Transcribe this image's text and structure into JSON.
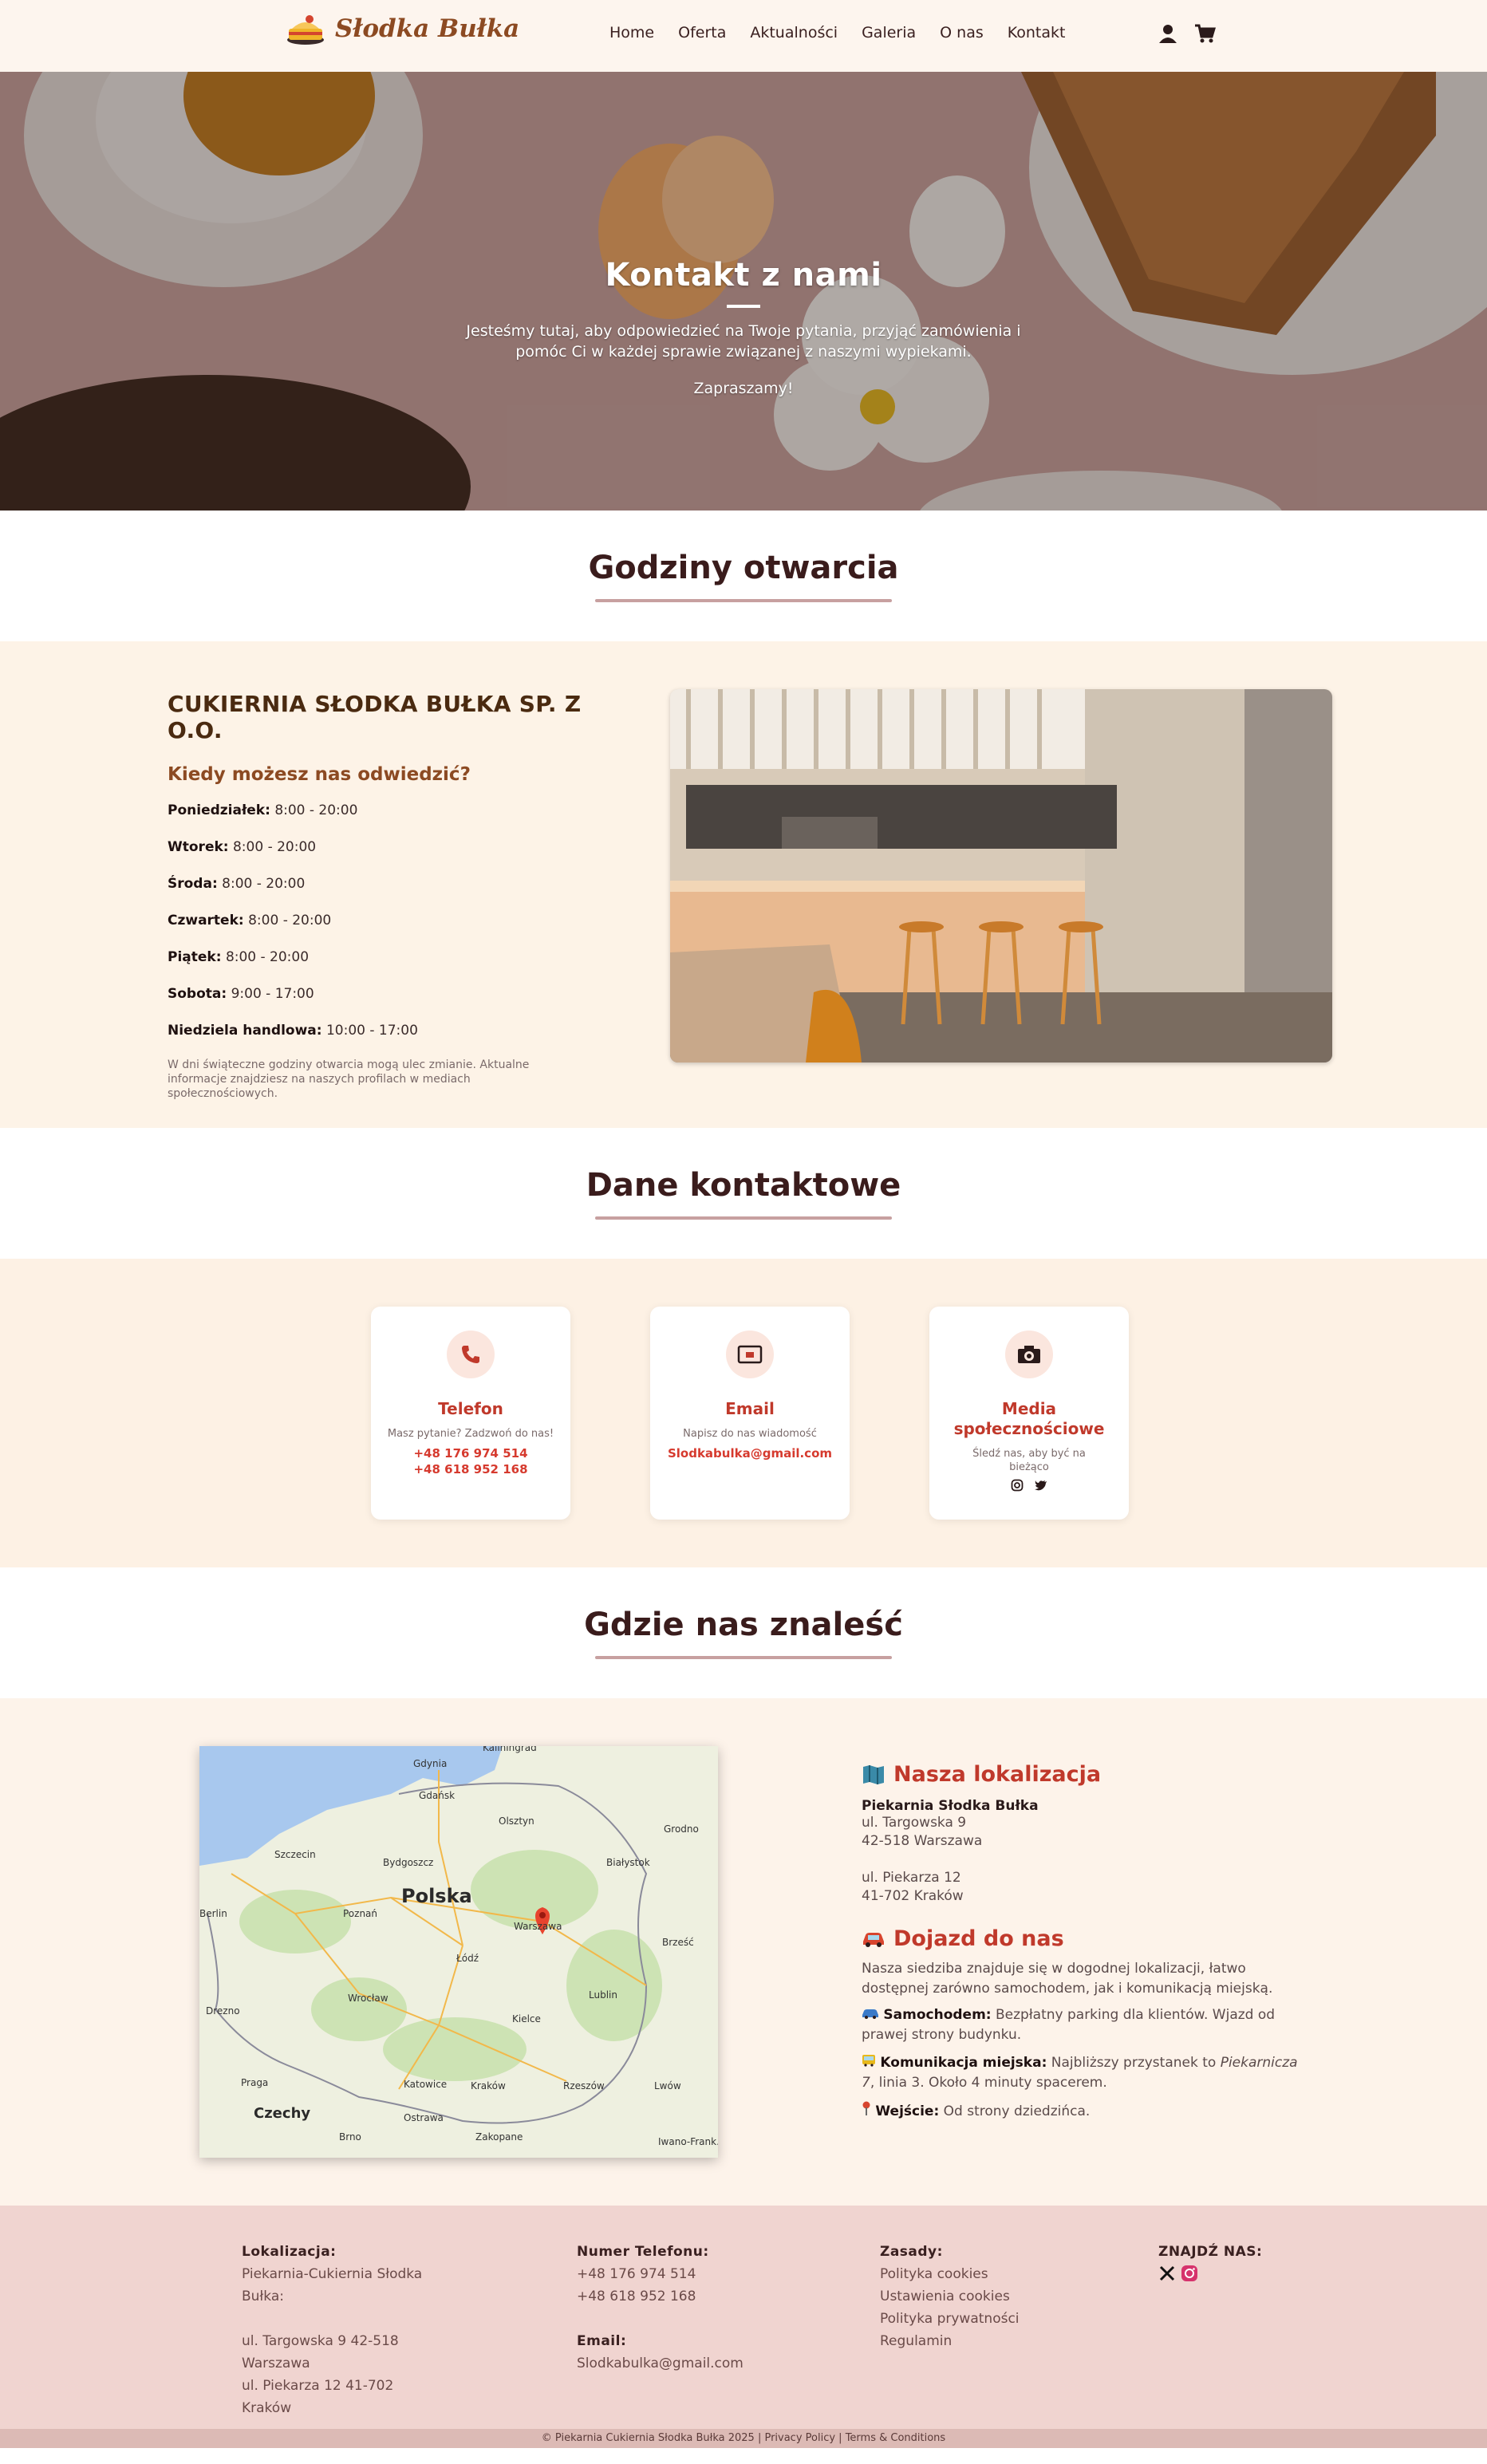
{
  "header": {
    "brand": "Słodka Bułka",
    "nav": [
      "Home",
      "Oferta",
      "Aktualności",
      "Galeria",
      "O nas",
      "Kontakt"
    ],
    "icons": [
      "user-icon",
      "cart-icon"
    ]
  },
  "hero": {
    "title": "Kontakt z nami",
    "text": "Jesteśmy tutaj, aby odpowiedzieć na Twoje pytania, przyjąć zamówienia i pomóc Ci w każdej sprawie związanej z naszymi wypiekami.",
    "invite": "Zapraszamy!"
  },
  "hours": {
    "section_title": "Godziny otwarcia",
    "company": "CUKIERNIA SŁODKA BUŁKA SP. Z O.O.",
    "subtitle": "Kiedy możesz nas odwiedzić?",
    "days": [
      {
        "day": "Poniedziałek:",
        "time": "8:00 - 20:00"
      },
      {
        "day": "Wtorek:",
        "time": "8:00 - 20:00"
      },
      {
        "day": "Środa:",
        "time": "8:00 - 20:00"
      },
      {
        "day": "Czwartek:",
        "time": "8:00 - 20:00"
      },
      {
        "day": "Piątek:",
        "time": "8:00 - 20:00"
      },
      {
        "day": "Sobota:",
        "time": "9:00 - 17:00"
      },
      {
        "day": "Niedziela handlowa:",
        "time": "10:00 - 17:00"
      }
    ],
    "note": "W dni świąteczne godziny otwarcia mogą ulec zmianie. Aktualne informacje znajdziesz na naszych profilach w mediach społecznościowych."
  },
  "contact": {
    "section_title": "Dane kontaktowe",
    "cards": [
      {
        "title": "Telefon",
        "desc": "Masz pytanie? Zadzwoń do nas!",
        "values": [
          "+48 176 974 514",
          "+48 618 952 168"
        ],
        "icon": "phone-icon"
      },
      {
        "title": "Email",
        "desc": "Napisz do nas wiadomość",
        "values": [
          "Slodkabulka@gmail.com"
        ],
        "icon": "mail-icon"
      },
      {
        "title": "Media społecznościowe",
        "desc": "Śledź nas, aby być na bieżąco",
        "values": [],
        "icon": "camera-icon"
      }
    ]
  },
  "location": {
    "section_title": "Gdzie nas znaleść",
    "heading": "Nasza lokalizacja",
    "name": "Piekarnia Słodka Bułka",
    "addr1": "ul. Targowska 9",
    "addr2": "42-518 Warszawa",
    "addr3": "ul. Piekarza 12",
    "addr4": "41-702 Kraków",
    "travel_heading": "Dojazd do nas",
    "travel_intro": "Nasza siedziba znajduje się w dogodnej lokalizacji, łatwo dostępnej zarówno samochodem, jak i komunikacją miejską.",
    "car_label": "Samochodem:",
    "car_text": "Bezpłatny parking dla klientów. Wjazd od prawej strony budynku.",
    "bus_label": "Komunikacja miejska:",
    "bus_text_1": "Najbliższy przystanek to",
    "bus_stop": "Piekarnicza 7",
    "bus_text_2": ", linia 3. Około 4 minuty spacerem.",
    "entry_label": "Wejście:",
    "entry_text": "Od strony dziedzińca.",
    "map": {
      "country": "Polska",
      "neighbor": "Czechy",
      "cities": [
        "Kaliningrad",
        "Gdynia",
        "Gdańsk",
        "Olsztyn",
        "Grodno",
        "Szczecin",
        "Bydgoszcz",
        "Białystok",
        "Berlin",
        "Poznań",
        "Warszawa",
        "Brześć",
        "Łódź",
        "Wrocław",
        "Lublin",
        "Drezno",
        "Kielce",
        "Praga",
        "Katowice",
        "Kraków",
        "Rzeszów",
        "Lwów",
        "Ostrawa",
        "Brno",
        "Zakopane",
        "Iwano-Frank."
      ]
    }
  },
  "footer": {
    "loc_title": "Lokalizacja:",
    "loc_lines": [
      "Piekarnia-Cukiernia Słodka",
      "Bułka:",
      "",
      "ul. Targowska 9 42-518",
      "Warszawa",
      "ul. Piekarza 12 41-702",
      "Kraków"
    ],
    "phone_title": "Numer Telefonu:",
    "phones": [
      "+48 176 974 514",
      "+48 618 952 168"
    ],
    "email_title": "Email:",
    "email": "Slodkabulka@gmail.com",
    "rules_title": "Zasady:",
    "rules": [
      "Polityka cookies",
      "Ustawienia cookies",
      "Polityka prywatności",
      "Regulamin"
    ],
    "find_title": "ZNAJDŹ NAS:",
    "copyright": "© Piekarnia Cukiernia Słodka Bułka 2025 | Privacy Policy | Terms & Conditions"
  },
  "colors": {
    "accent": "#c0392b",
    "cream": "#fdf3e7",
    "footer": "#f0d4d0",
    "brand": "#8c4a22"
  }
}
